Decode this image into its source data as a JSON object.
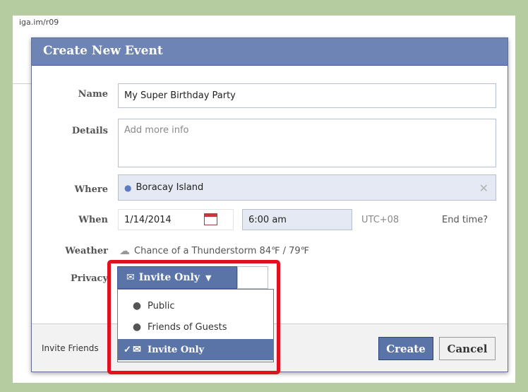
{
  "background": {
    "url_fragment": "iga.im/r09"
  },
  "dialog": {
    "title": "Create New Event",
    "name_label": "Name",
    "name_value": "My Super Birthday Party",
    "details_label": "Details",
    "details_placeholder": "Add more info",
    "where_label": "Where",
    "where_value": "Boracay Island",
    "when_label": "When",
    "date_value": "1/14/2014",
    "time_value": "6:00 am",
    "timezone": "UTC+08",
    "end_time_link": "End time?",
    "weather_label": "Weather",
    "weather_text": "Chance of a Thunderstorm 84℉ / 79℉",
    "privacy_label": "Privacy",
    "privacy_selected": "Invite Only",
    "privacy_options": [
      "Public",
      "Friends of Guests",
      "Invite Only"
    ],
    "invite_friends_label": "Invite Friends",
    "create_button": "Create",
    "cancel_button": "Cancel"
  },
  "colors": {
    "title_bar": "#6d84b4",
    "button_primary": "#5b74a8",
    "highlight_border": "#e01020",
    "background": "#b5cca0"
  },
  "icons": [
    "map-pin-icon",
    "calendar-icon",
    "clear-icon",
    "weather-cloud-icon",
    "envelope-icon",
    "caret-down-icon",
    "globe-icon",
    "people-icon",
    "checkmark-icon"
  ]
}
